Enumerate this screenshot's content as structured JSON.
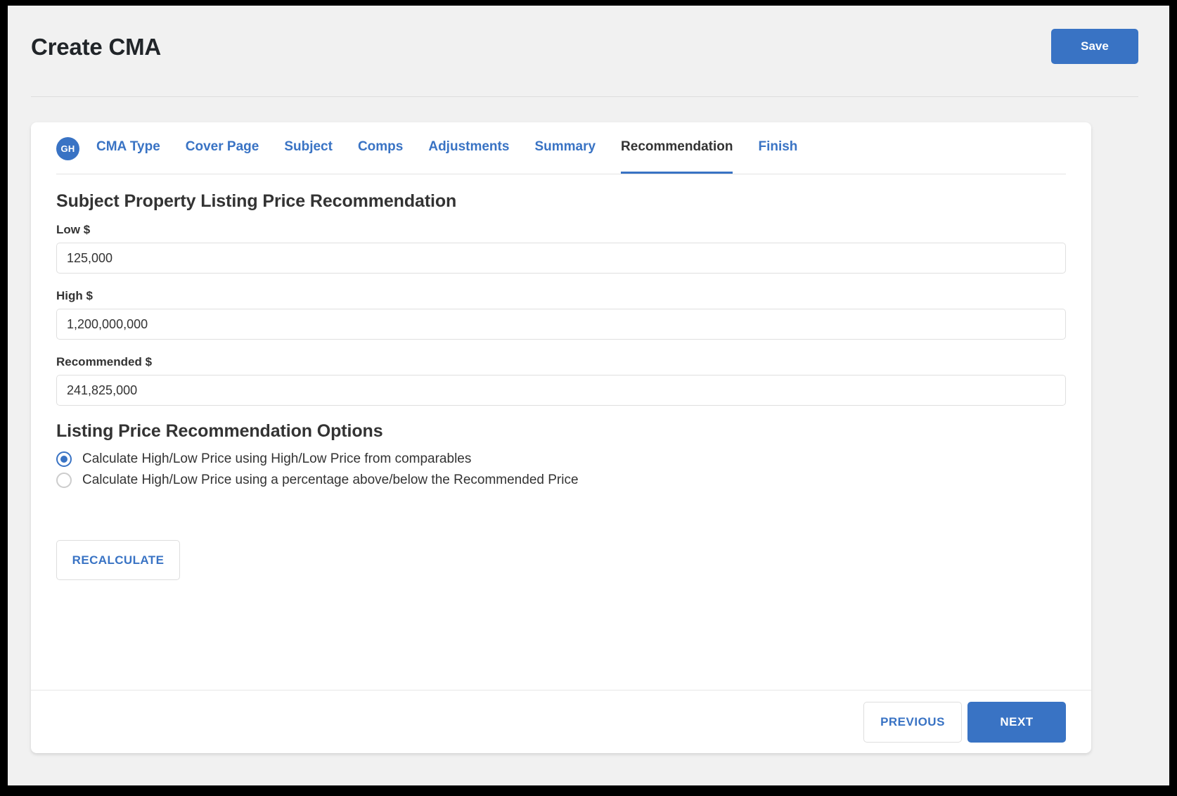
{
  "header": {
    "title": "Create CMA",
    "save_label": "Save"
  },
  "tabs": {
    "avatar_initials": "GH",
    "items": [
      {
        "label": "CMA Type",
        "active": false
      },
      {
        "label": "Cover Page",
        "active": false
      },
      {
        "label": "Subject",
        "active": false
      },
      {
        "label": "Comps",
        "active": false
      },
      {
        "label": "Adjustments",
        "active": false
      },
      {
        "label": "Summary",
        "active": false
      },
      {
        "label": "Recommendation",
        "active": true
      },
      {
        "label": "Finish",
        "active": false
      }
    ]
  },
  "main": {
    "section_title": "Subject Property Listing Price Recommendation",
    "fields": [
      {
        "label": "Low $",
        "value": "125,000",
        "placeholder": ""
      },
      {
        "label": "High $",
        "value": "1,200,000,000",
        "placeholder": ""
      },
      {
        "label": "Recommended $",
        "value": "241,825,000",
        "placeholder": ""
      }
    ],
    "options_title": "Listing Price Recommendation Options",
    "options": [
      {
        "label": "Calculate High/Low Price using High/Low Price from comparables",
        "selected": true
      },
      {
        "label": "Calculate High/Low Price using a percentage above/below the Recommended Price",
        "selected": false
      }
    ],
    "recalculate_label": "RECALCULATE"
  },
  "footer": {
    "previous_label": "PREVIOUS",
    "next_label": "NEXT"
  },
  "colors": {
    "accent": "#3973c4",
    "page_background": "#f1f1f1",
    "card_background": "#ffffff",
    "text": "#333333",
    "border": "#dfdfdf"
  }
}
